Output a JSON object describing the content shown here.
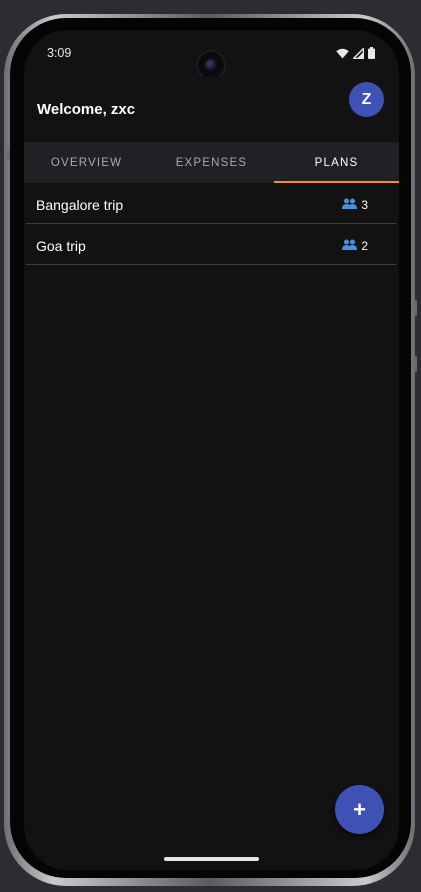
{
  "status_bar": {
    "time": "3:09",
    "icons": [
      "wifi-icon",
      "signal-icon",
      "battery-icon"
    ]
  },
  "header": {
    "welcome": "Welcome, zxc",
    "avatar_letter": "Z"
  },
  "tabs": [
    {
      "label": "OVERVIEW",
      "active": false
    },
    {
      "label": "EXPENSES",
      "active": false
    },
    {
      "label": "PLANS",
      "active": true
    }
  ],
  "plans": [
    {
      "name": "Bangalore trip",
      "members": "3"
    },
    {
      "name": "Goa trip",
      "members": "2"
    }
  ],
  "fab": {
    "label": "+"
  },
  "colors": {
    "accent": "#3f51b5",
    "tab_indicator": "#ff8a2a",
    "members_icon": "#4a90e2",
    "background": "#121212"
  }
}
